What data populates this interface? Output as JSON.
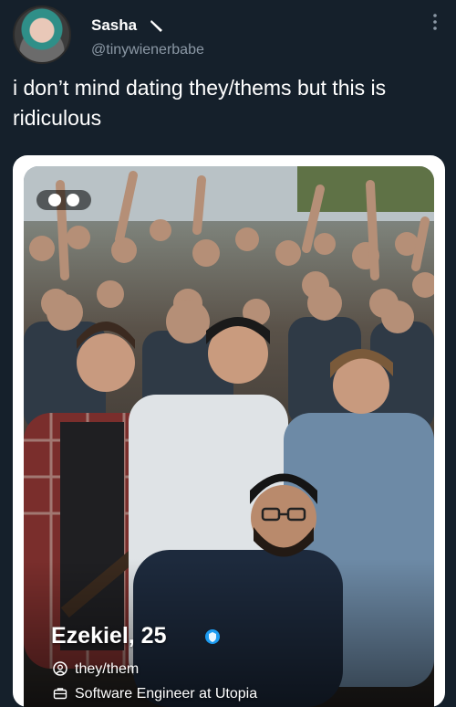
{
  "tweet": {
    "display_name": "Sasha",
    "handle": "@tinywienerbabe",
    "text": "i don’t mind dating they/thems but this is ridiculous",
    "name_icon": "knife-icon",
    "menu_icon": "more-options-icon"
  },
  "profile_card": {
    "name_age": "Ezekiel, 25",
    "badge_icon": "verified-icon",
    "pronouns": "they/them",
    "pronouns_icon": "person-icon",
    "job": "Software Engineer at Utopia",
    "job_icon": "briefcase-icon",
    "photo_controls_icon": "photo-pager-icon"
  },
  "colors": {
    "background": "#15202b",
    "secondary_text": "#8b98a5",
    "verified": "#1d9bf0"
  }
}
